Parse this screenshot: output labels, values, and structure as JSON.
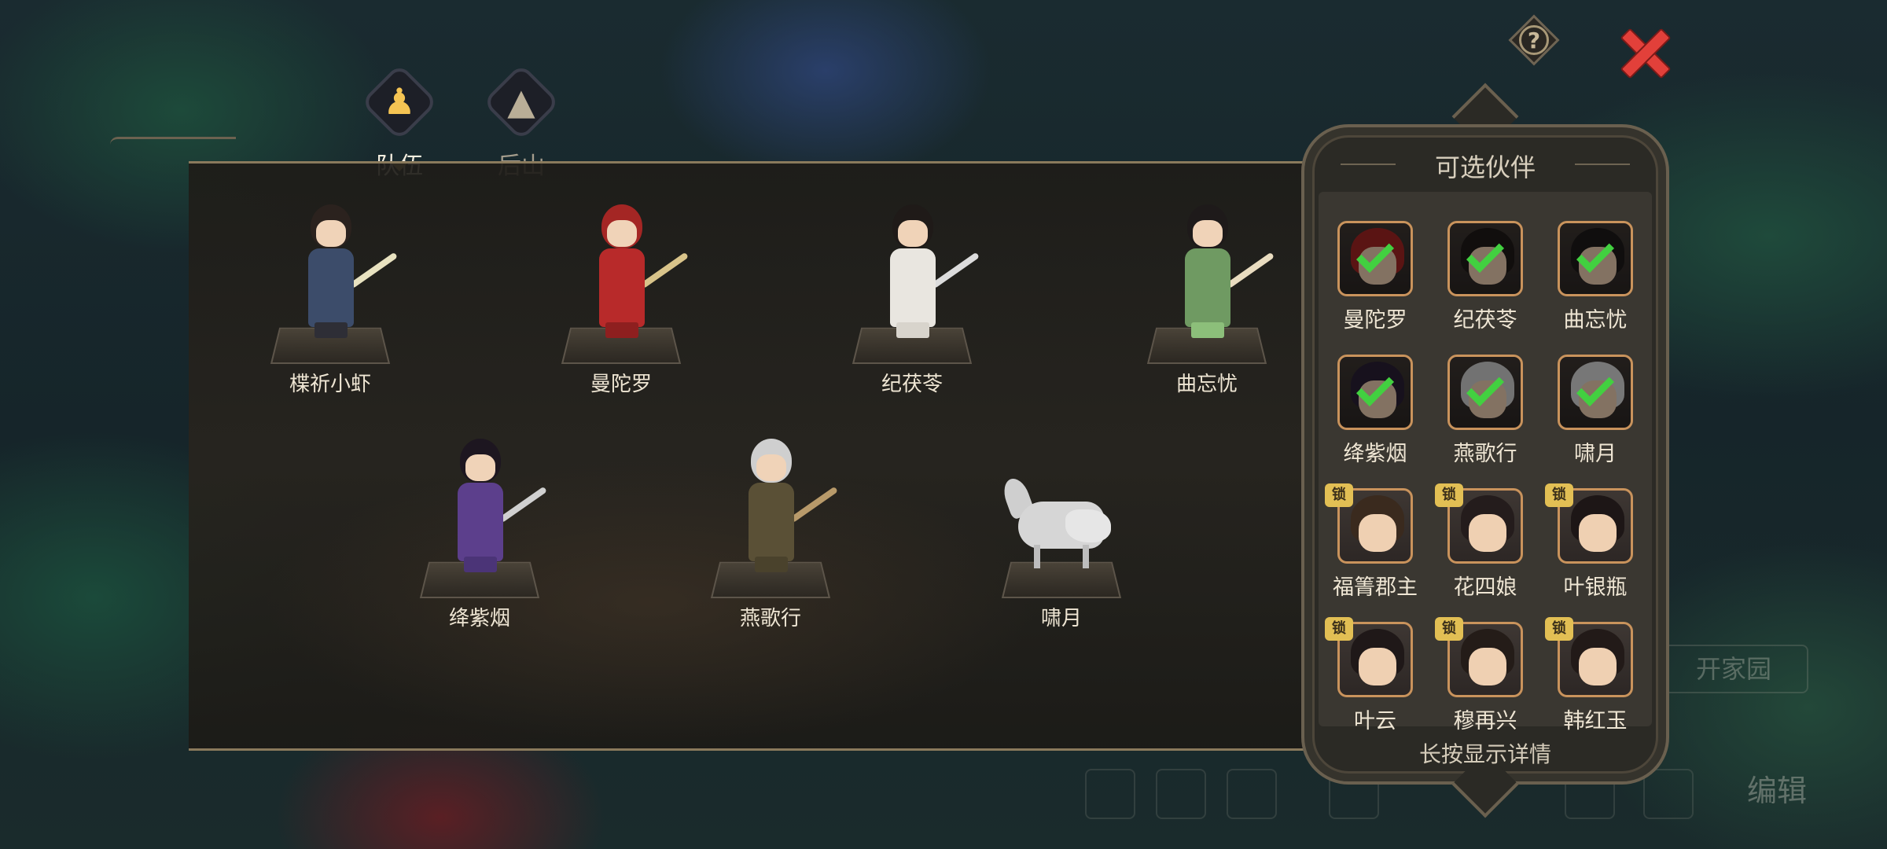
{
  "header": {
    "help_glyph": "?",
    "tabs": [
      {
        "label": "队伍",
        "icon": "person-icon",
        "active": true
      },
      {
        "label": "后山",
        "icon": "mountain-icon",
        "active": false
      }
    ]
  },
  "team": {
    "members": [
      {
        "name": "楪祈小虾",
        "hair": "#2b221e",
        "outfit": "#3c4c6a",
        "legs": "#2e2e36",
        "prop": "#e8e2c0"
      },
      {
        "name": "曼陀罗",
        "hair": "#a42624",
        "outfit": "#b82a2a",
        "legs": "#8e1f1f",
        "prop": "#d9c48a"
      },
      {
        "name": "纪茯苓",
        "hair": "#1f1a18",
        "outfit": "#e9e6e0",
        "legs": "#d8d4cc",
        "prop": "#dcdcdc"
      },
      {
        "name": "曲忘忧",
        "hair": "#1e1a1a",
        "outfit": "#6f9a62",
        "legs": "#8cbf7a",
        "prop": "#e9dcc0"
      },
      {
        "name": "绛紫烟",
        "hair": "#1d1620",
        "outfit": "#5c3f8c",
        "legs": "#4b3477",
        "prop": "#d0d0d0"
      },
      {
        "name": "燕歌行",
        "hair": "#cfcfcf",
        "outfit": "#5a5036",
        "legs": "#4a422c",
        "prop": "#b89a6a"
      },
      {
        "name": "啸月",
        "hair": "",
        "outfit": "",
        "legs": "",
        "prop": ""
      }
    ]
  },
  "partners": {
    "title": "可选伙伴",
    "hint": "长按显示详情",
    "lock_glyph": "锁",
    "items": [
      {
        "name": "曼陀罗",
        "selected": true,
        "locked": false,
        "hair": "#a42624"
      },
      {
        "name": "纪茯苓",
        "selected": true,
        "locked": false,
        "hair": "#1f1a18"
      },
      {
        "name": "曲忘忧",
        "selected": true,
        "locked": false,
        "hair": "#1e1a1a"
      },
      {
        "name": "绛紫烟",
        "selected": true,
        "locked": false,
        "hair": "#2a1f35"
      },
      {
        "name": "燕歌行",
        "selected": true,
        "locked": false,
        "hair": "#cfcfcf"
      },
      {
        "name": "啸月",
        "selected": true,
        "locked": false,
        "hair": "#d9d9d9"
      },
      {
        "name": "福箐郡主",
        "selected": false,
        "locked": true,
        "hair": "#3a2a1e"
      },
      {
        "name": "花四娘",
        "selected": false,
        "locked": true,
        "hair": "#241c1c"
      },
      {
        "name": "叶银瓶",
        "selected": false,
        "locked": true,
        "hair": "#1d1616"
      },
      {
        "name": "叶云",
        "selected": false,
        "locked": true,
        "hair": "#1f1818"
      },
      {
        "name": "穆再兴",
        "selected": false,
        "locked": true,
        "hair": "#241c18"
      },
      {
        "name": "韩红玉",
        "selected": false,
        "locked": true,
        "hair": "#221a18"
      }
    ]
  },
  "background": {
    "bar_text": "开家园",
    "edit_text": "编辑"
  }
}
